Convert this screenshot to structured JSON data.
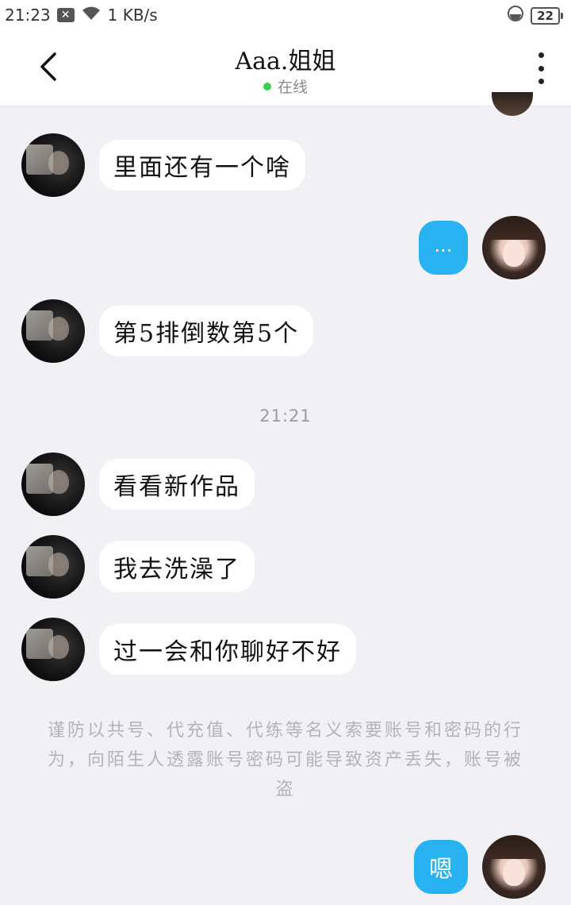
{
  "status_bar": {
    "time": "21:23",
    "notif_icon": "close-box-icon",
    "network_speed": "1 KB/s",
    "battery": "22"
  },
  "header": {
    "title": "Aaa.姐姐",
    "status": "在线",
    "status_color": "#3ccf4e"
  },
  "messages": [
    {
      "side": "left",
      "text": "里面还有一个啥"
    },
    {
      "side": "right",
      "text": "..."
    },
    {
      "side": "left",
      "text": "第5排倒数第5个"
    },
    {
      "side": "left",
      "text": "看看新作品"
    },
    {
      "side": "left",
      "text": "我去洗澡了"
    },
    {
      "side": "left",
      "text": "过一会和你聊好不好"
    },
    {
      "side": "right",
      "text": "嗯"
    }
  ],
  "time_divider": "21:21",
  "security_notice": "谨防以共号、代充值、代练等名义索要账号和密码的行为，向陌生人透露账号密码可能导致资产丢失，账号被盗",
  "colors": {
    "accent_bubble": "#28b2f2",
    "background": "#f1f1f5"
  }
}
